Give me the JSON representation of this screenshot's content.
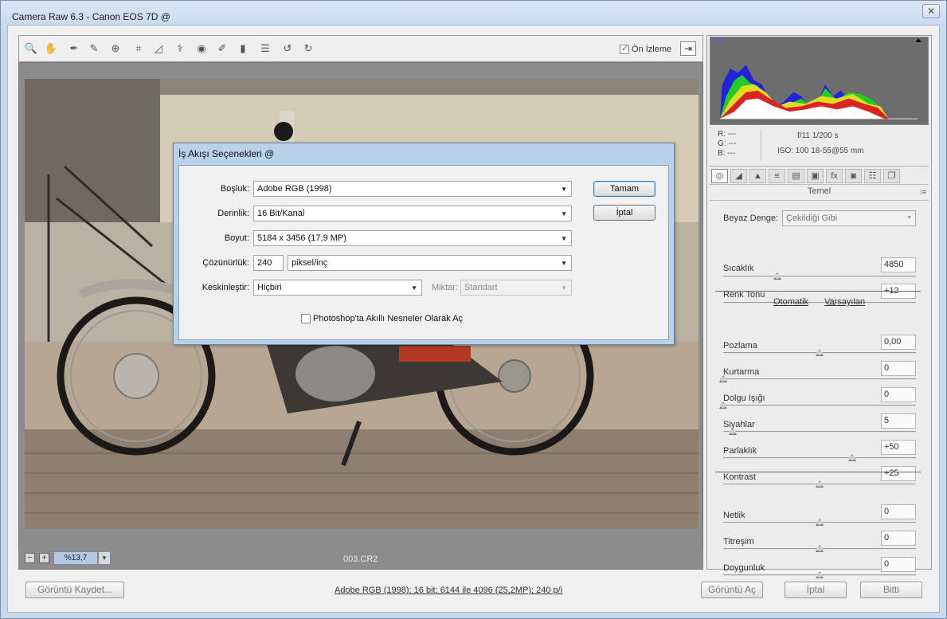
{
  "window": {
    "title": "Camera Raw 6.3  -  Canon EOS 7D @",
    "close_glyph": "✕"
  },
  "toolbar": {
    "tools": [
      {
        "icon": "zoom-tool-icon",
        "glyph": "🔍"
      },
      {
        "icon": "hand-tool-icon",
        "glyph": "✋"
      },
      {
        "icon": "white-balance-tool-icon",
        "glyph": "✒"
      },
      {
        "icon": "color-sampler-tool-icon",
        "glyph": "✎"
      },
      {
        "icon": "targeted-adjustment-tool-icon",
        "glyph": "⊕"
      },
      {
        "icon": "crop-tool-icon",
        "glyph": "⌗"
      },
      {
        "icon": "straighten-tool-icon",
        "glyph": "◿"
      },
      {
        "icon": "spot-removal-tool-icon",
        "glyph": "⚕"
      },
      {
        "icon": "red-eye-removal-tool-icon",
        "glyph": "◉"
      },
      {
        "icon": "adjustment-brush-icon",
        "glyph": "✐"
      },
      {
        "icon": "graduated-filter-icon",
        "glyph": "▮"
      },
      {
        "icon": "preferences-icon",
        "glyph": "☰"
      },
      {
        "icon": "rotate-ccw-icon",
        "glyph": "↺"
      },
      {
        "icon": "rotate-cw-icon",
        "glyph": "↻"
      }
    ],
    "preview_label": "Ön İzleme",
    "fullscreen_glyph": "⇥"
  },
  "preview": {
    "zoom_minus": "−",
    "zoom_plus": "+",
    "zoom_value": "%13,7",
    "zoom_dropdown_glyph": "▼",
    "filename": "003.CR2"
  },
  "histogram_readout": {
    "r": "R:   ---",
    "g": "G:   ---",
    "b": "B:   ---",
    "aperture_shutter": "f/11    1/200 s",
    "iso_lens": "ISO: 100    18-55@55 mm"
  },
  "panel_tabs": [
    {
      "icon": "basic-tab-icon",
      "glyph": "◎"
    },
    {
      "icon": "tone-curve-tab-icon",
      "glyph": "◢"
    },
    {
      "icon": "detail-tab-icon",
      "glyph": "▲"
    },
    {
      "icon": "hsl-tab-icon",
      "glyph": "≡"
    },
    {
      "icon": "split-toning-tab-icon",
      "glyph": "▤"
    },
    {
      "icon": "lens-corrections-tab-icon",
      "glyph": "▣"
    },
    {
      "icon": "effects-tab-icon",
      "glyph": "fx"
    },
    {
      "icon": "camera-calibration-tab-icon",
      "glyph": "◙"
    },
    {
      "icon": "presets-tab-icon",
      "glyph": "☷"
    },
    {
      "icon": "snapshots-tab-icon",
      "glyph": "❐"
    }
  ],
  "basic_panel": {
    "title": "Temel",
    "menu_glyph": "⁝≡",
    "white_balance_label": "Beyaz Denge:",
    "white_balance_value": "Çekildiği Gibi",
    "auto_link": "Otomatik",
    "default_link": "Varsayılan",
    "sliders": [
      {
        "label": "Sıcaklık",
        "value": "4850",
        "position": 0.28
      },
      {
        "label": "Renk Tonu",
        "value": "+12",
        "position": 0.56
      },
      {
        "label": "Pozlama",
        "value": "0,00",
        "position": 0.5
      },
      {
        "label": "Kurtarma",
        "value": "0",
        "position": 0.0
      },
      {
        "label": "Dolgu Işığı",
        "value": "0",
        "position": 0.0
      },
      {
        "label": "Siyahlar",
        "value": "5",
        "position": 0.05
      },
      {
        "label": "Parlaklık",
        "value": "+50",
        "position": 0.67
      },
      {
        "label": "Kontrast",
        "value": "+25",
        "position": 0.5
      },
      {
        "label": "Netlik",
        "value": "0",
        "position": 0.5
      },
      {
        "label": "Titreşim",
        "value": "0",
        "position": 0.5
      },
      {
        "label": "Doygunluk",
        "value": "0",
        "position": 0.5
      }
    ]
  },
  "bottom_bar": {
    "save_image": "Görüntü Kaydet...",
    "workflow_link": "Adobe RGB (1998); 16 bit; 6144 ile 4096 (25,2MP); 240 p/i",
    "open_image": "Görüntü Aç",
    "cancel": "İptal",
    "done": "Bitti"
  },
  "dialog": {
    "title": "İş Akışı Seçenekleri @",
    "space_label": "Boşluk:",
    "space_value": "Adobe RGB (1998)",
    "depth_label": "Derinlik:",
    "depth_value": "16 Bit/Kanal",
    "size_label": "Boyut:",
    "size_value": "5184 x 3456 (17,9 MP)",
    "resolution_label": "Çözünürlük:",
    "resolution_value": "240",
    "resolution_unit": "piksel/inç",
    "sharpen_label": "Keskinleştir:",
    "sharpen_value": "Hiçbiri",
    "amount_label": "Miktar:",
    "amount_value": "Standart",
    "smart_objects_label": "Photoshop'ta Akıllı Nesneler Olarak Aç",
    "ok": "Tamam",
    "cancel": "İptal"
  }
}
